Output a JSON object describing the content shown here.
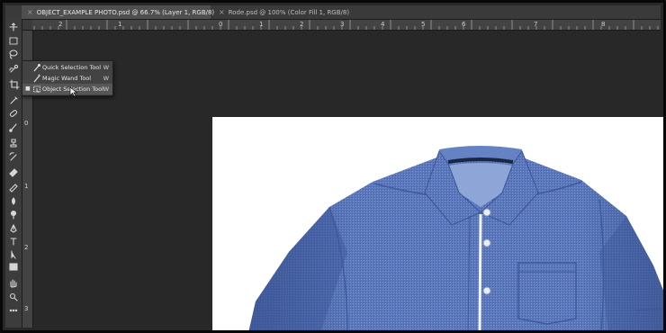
{
  "tabs": [
    {
      "label": "OBJECT_EXAMPLE PHOTO.psd @ 66.7% (Layer 1, RGB/8)",
      "active": true,
      "close": "×"
    },
    {
      "label": "Rode.psd @ 100% (Color Fill 1, RGB/8)",
      "active": false,
      "close": "×"
    }
  ],
  "ruler_top": [
    "2",
    "1",
    "0",
    "1",
    "2",
    "3",
    "4",
    "5",
    "6",
    "7",
    "8"
  ],
  "ruler_left": [
    "1",
    "0",
    "1",
    "2",
    "3"
  ],
  "flyout": {
    "items": [
      {
        "label": "Quick Selection Tool",
        "shortcut": "W",
        "icon": "quick-selection-icon"
      },
      {
        "label": "Magic Wand Tool",
        "shortcut": "W",
        "icon": "magic-wand-icon"
      },
      {
        "label": "Object Selection Tool",
        "shortcut": "W",
        "icon": "object-selection-icon",
        "active": true,
        "bullet": "■"
      }
    ]
  },
  "tools": [
    "move-icon",
    "marquee-icon",
    "lasso-icon",
    "quick-selection-icon",
    "crop-icon",
    "eyedropper-icon",
    "healing-icon",
    "brush-icon",
    "stamp-icon",
    "history-brush-icon",
    "eraser-icon",
    "gradient-icon",
    "blur-icon",
    "dodge-icon",
    "pen-icon",
    "type-icon",
    "path-selection-icon",
    "rectangle-icon",
    "hand-icon",
    "zoom-icon",
    "more-icon"
  ],
  "colors": {
    "canvas_bg": "#282828",
    "panel": "#3c3c3c",
    "shirt": "#5574b8",
    "document": "#ffffff"
  }
}
